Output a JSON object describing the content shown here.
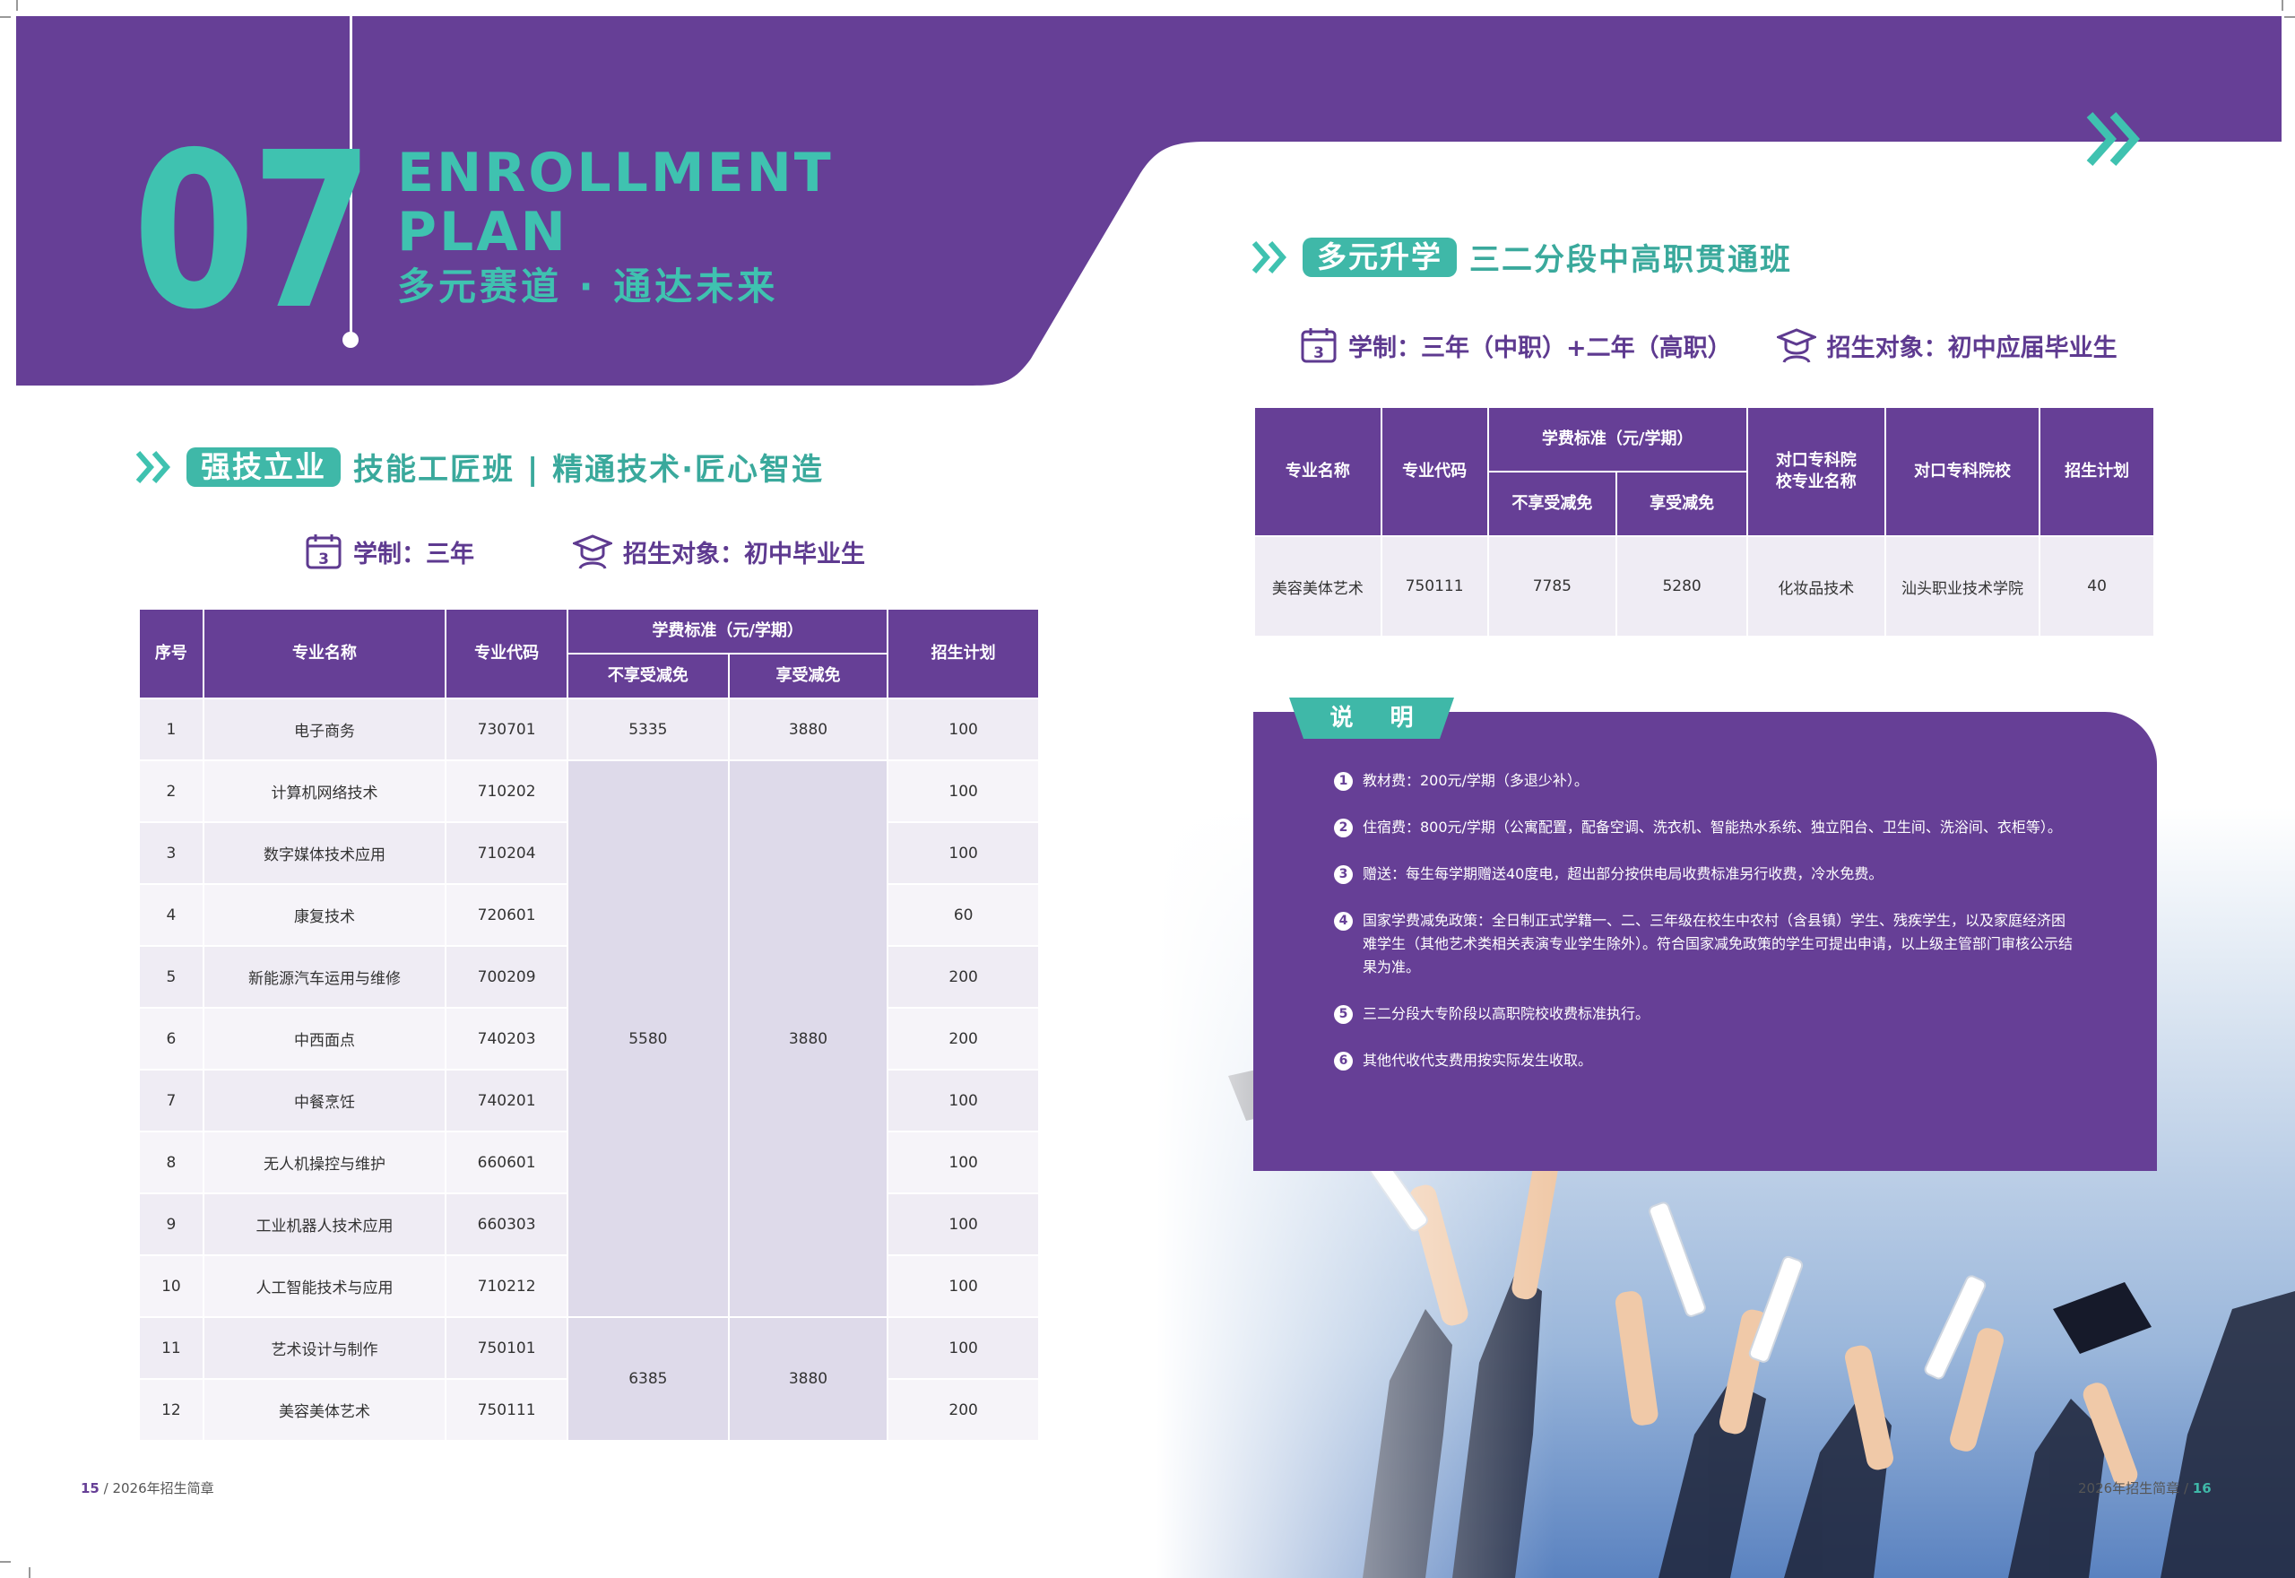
{
  "header": {
    "number": "07",
    "title_en": "ENROLLMENT\nPLAN",
    "slogan": "多元赛道 · 通达未来"
  },
  "colors": {
    "purple": "#663f96",
    "teal": "#3fc2b0",
    "light_row": "#efecf4",
    "merged_cell": "#dedaea"
  },
  "section1": {
    "pill": "强技立业",
    "title": "技能工匠班 | 精通技术·匠心智造",
    "duration_label": "学制：三年",
    "target_label": "招生对象：初中毕业生",
    "icons": [
      "calendar-icon",
      "graduate-icon",
      "double-chevron-icon"
    ],
    "table": {
      "headers": {
        "no": "序号",
        "major": "专业名称",
        "code": "专业代码",
        "fee_group": "学费标准（元/学期）",
        "fee_no_discount": "不享受减免",
        "fee_discount": "享受减免",
        "plan": "招生计划"
      },
      "rows": [
        {
          "no": "1",
          "major": "电子商务",
          "code": "730701",
          "plan": "100"
        },
        {
          "no": "2",
          "major": "计算机网络技术",
          "code": "710202",
          "plan": "100"
        },
        {
          "no": "3",
          "major": "数字媒体技术应用",
          "code": "710204",
          "plan": "100"
        },
        {
          "no": "4",
          "major": "康复技术",
          "code": "720601",
          "plan": "60"
        },
        {
          "no": "5",
          "major": "新能源汽车运用与维修",
          "code": "700209",
          "plan": "200"
        },
        {
          "no": "6",
          "major": "中西面点",
          "code": "740203",
          "plan": "200"
        },
        {
          "no": "7",
          "major": "中餐烹饪",
          "code": "740201",
          "plan": "100"
        },
        {
          "no": "8",
          "major": "无人机操控与维护",
          "code": "660601",
          "plan": "100"
        },
        {
          "no": "9",
          "major": "工业机器人技术应用",
          "code": "660303",
          "plan": "100"
        },
        {
          "no": "10",
          "major": "人工智能技术与应用",
          "code": "710212",
          "plan": "100"
        },
        {
          "no": "11",
          "major": "艺术设计与制作",
          "code": "750101",
          "plan": "100"
        },
        {
          "no": "12",
          "major": "美容美体艺术",
          "code": "750111",
          "plan": "200"
        }
      ],
      "fee_groups": [
        {
          "no_discount": "5335",
          "discount": "3880"
        },
        {
          "no_discount": "5580",
          "discount": "3880"
        },
        {
          "no_discount": "6385",
          "discount": "3880"
        }
      ]
    }
  },
  "section2": {
    "pill": "多元升学",
    "title": "三二分段中高职贯通班",
    "duration_label": "学制：三年（中职）+二年（高职）",
    "target_label": "招生对象：初中应届毕业生",
    "table": {
      "headers": {
        "major": "专业名称",
        "code": "专业代码",
        "fee_group": "学费标准（元/学期）",
        "fee_no_discount": "不享受减免",
        "fee_discount": "享受减免",
        "college_major": "对口专科院校专业名称",
        "college": "对口专科院校",
        "plan": "招生计划"
      },
      "row": {
        "major": "美容美体艺术",
        "code": "750111",
        "fee_no_discount": "7785",
        "fee_discount": "5280",
        "college_major": "化妆品技术",
        "college": "汕头职业技术学院",
        "plan": "40"
      }
    }
  },
  "notes": {
    "title": "说 明",
    "items": [
      {
        "num": "1",
        "text": "教材费：200元/学期（多退少补）。"
      },
      {
        "num": "2",
        "text": "住宿费：800元/学期（公寓配置，配备空调、洗衣机、智能热水系统、独立阳台、卫生间、洗浴间、衣柜等）。"
      },
      {
        "num": "3",
        "text": "赠送：每生每学期赠送40度电，超出部分按供电局收费标准另行收费，冷水免费。"
      },
      {
        "num": "4",
        "text": "国家学费减免政策：全日制正式学籍一、二、三年级在校生中农村（含县镇）学生、残疾学生，以及家庭经济困难学生（其他艺术类相关表演专业学生除外）。符合国家减免政策的学生可提出申请，以上级主管部门审核公示结果为准。"
      },
      {
        "num": "5",
        "text": "三二分段大专阶段以高职院校收费标准执行。"
      },
      {
        "num": "6",
        "text": "其他代收代支费用按实际发生收取。"
      }
    ]
  },
  "footer": {
    "left_page": "15",
    "left_text": " / 2026年招生简章",
    "right_text": "2026年招生简章 / ",
    "right_page": "16"
  }
}
